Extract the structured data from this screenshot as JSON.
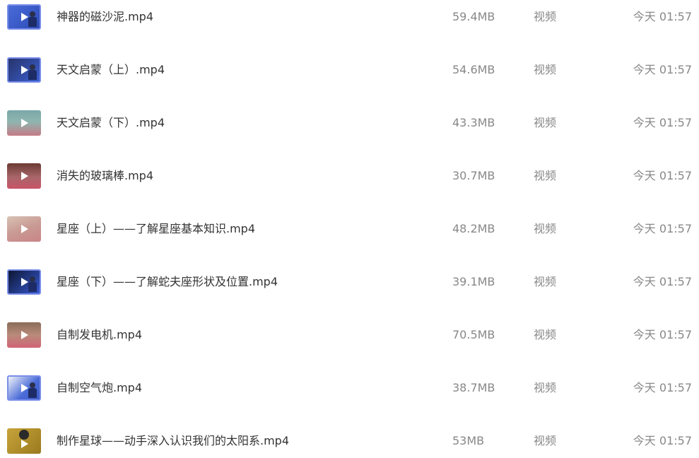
{
  "files": [
    {
      "name": "神器的磁沙泥.mp4",
      "size": "59.4MB",
      "type": "视频",
      "time": "今天 01:57",
      "thumb_icon": "video-thumbnail-icon"
    },
    {
      "name": "天文启蒙（上）.mp4",
      "size": "54.6MB",
      "type": "视频",
      "time": "今天 01:57",
      "thumb_icon": "video-thumbnail-icon"
    },
    {
      "name": "天文启蒙（下）.mp4",
      "size": "43.3MB",
      "type": "视频",
      "time": "今天 01:57",
      "thumb_icon": "video-thumbnail-icon"
    },
    {
      "name": "消失的玻璃棒.mp4",
      "size": "30.7MB",
      "type": "视频",
      "time": "今天 01:57",
      "thumb_icon": "video-thumbnail-icon"
    },
    {
      "name": "星座（上）——了解星座基本知识.mp4",
      "size": "48.2MB",
      "type": "视频",
      "time": "今天 01:57",
      "thumb_icon": "video-thumbnail-icon"
    },
    {
      "name": "星座（下）——了解蛇夫座形状及位置.mp4",
      "size": "39.1MB",
      "type": "视频",
      "time": "今天 01:57",
      "thumb_icon": "video-thumbnail-icon"
    },
    {
      "name": "自制发电机.mp4",
      "size": "70.5MB",
      "type": "视频",
      "time": "今天 01:57",
      "thumb_icon": "video-thumbnail-icon"
    },
    {
      "name": "自制空气炮.mp4",
      "size": "38.7MB",
      "type": "视频",
      "time": "今天 01:57",
      "thumb_icon": "video-thumbnail-icon"
    },
    {
      "name": "制作星球——动手深入认识我们的太阳系.mp4",
      "size": "53MB",
      "type": "视频",
      "time": "今天 01:57",
      "thumb_icon": "video-thumbnail-icon"
    }
  ],
  "colors": {
    "name_text": "#333333",
    "meta_text": "#888888",
    "background": "#ffffff"
  }
}
